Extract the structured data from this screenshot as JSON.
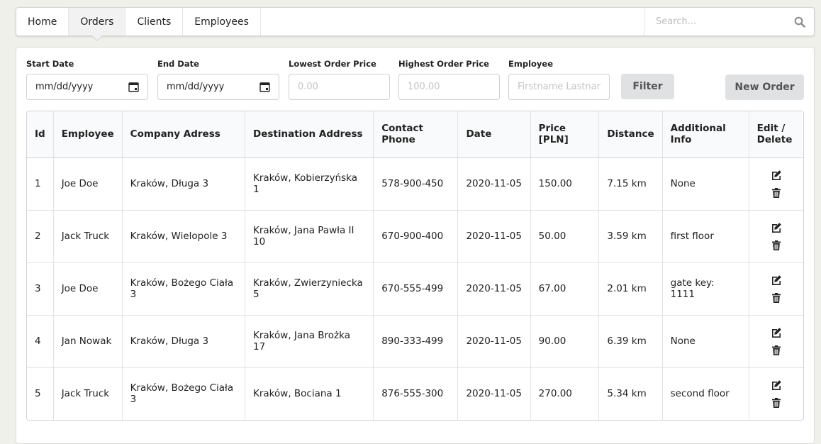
{
  "nav": {
    "items": [
      {
        "label": "Home"
      },
      {
        "label": "Orders"
      },
      {
        "label": "Clients"
      },
      {
        "label": "Employees"
      }
    ],
    "active": "Orders",
    "search_placeholder": "Search..."
  },
  "filters": {
    "start_date": {
      "label": "Start Date",
      "value": "mm/dd/yyyy"
    },
    "end_date": {
      "label": "End Date",
      "value": "mm/dd/yyyy"
    },
    "lowest_price": {
      "label": "Lowest Order Price",
      "placeholder": "0.00"
    },
    "highest_price": {
      "label": "Highest Order Price",
      "placeholder": "100.00"
    },
    "employee": {
      "label": "Employee",
      "placeholder": "Firstname Lastname"
    },
    "filter_label": "Filter",
    "new_order_label": "New Order"
  },
  "table": {
    "headers": [
      "Id",
      "Employee",
      "Company Adress",
      "Destination Address",
      "Contact Phone",
      "Date",
      "Price [PLN]",
      "Distance",
      "Additional Info",
      "Edit / Delete"
    ],
    "rows": [
      {
        "id": "1",
        "employee": "Joe Doe",
        "company": "Kraków, Długa 3",
        "destination": "Kraków, Kobierzyńska 1",
        "phone": "578-900-450",
        "date": "2020-11-05",
        "price": "150.00",
        "distance": "7.15 km",
        "info": "None"
      },
      {
        "id": "2",
        "employee": "Jack Truck",
        "company": "Kraków, Wielopole 3",
        "destination": "Kraków, Jana Pawła II 10",
        "phone": "670-900-400",
        "date": "2020-11-05",
        "price": "50.00",
        "distance": "3.59 km",
        "info": "first floor"
      },
      {
        "id": "3",
        "employee": "Joe Doe",
        "company": "Kraków, Bożego Ciała 3",
        "destination": "Kraków, Zwierzyniecka 5",
        "phone": "670-555-499",
        "date": "2020-11-05",
        "price": "67.00",
        "distance": "2.01 km",
        "info": "gate key: 1111"
      },
      {
        "id": "4",
        "employee": "Jan Nowak",
        "company": "Kraków, Długa 3",
        "destination": "Kraków, Jana Brożka 17",
        "phone": "890-333-499",
        "date": "2020-11-05",
        "price": "90.00",
        "distance": "6.39 km",
        "info": "None"
      },
      {
        "id": "5",
        "employee": "Jack Truck",
        "company": "Kraków, Bożego Ciała 3",
        "destination": "Kraków, Bociana 1",
        "phone": "876-555-300",
        "date": "2020-11-05",
        "price": "270.00",
        "distance": "5.34 km",
        "info": "second floor"
      }
    ],
    "icons": {
      "edit": "edit-icon",
      "delete": "trash-icon"
    }
  }
}
